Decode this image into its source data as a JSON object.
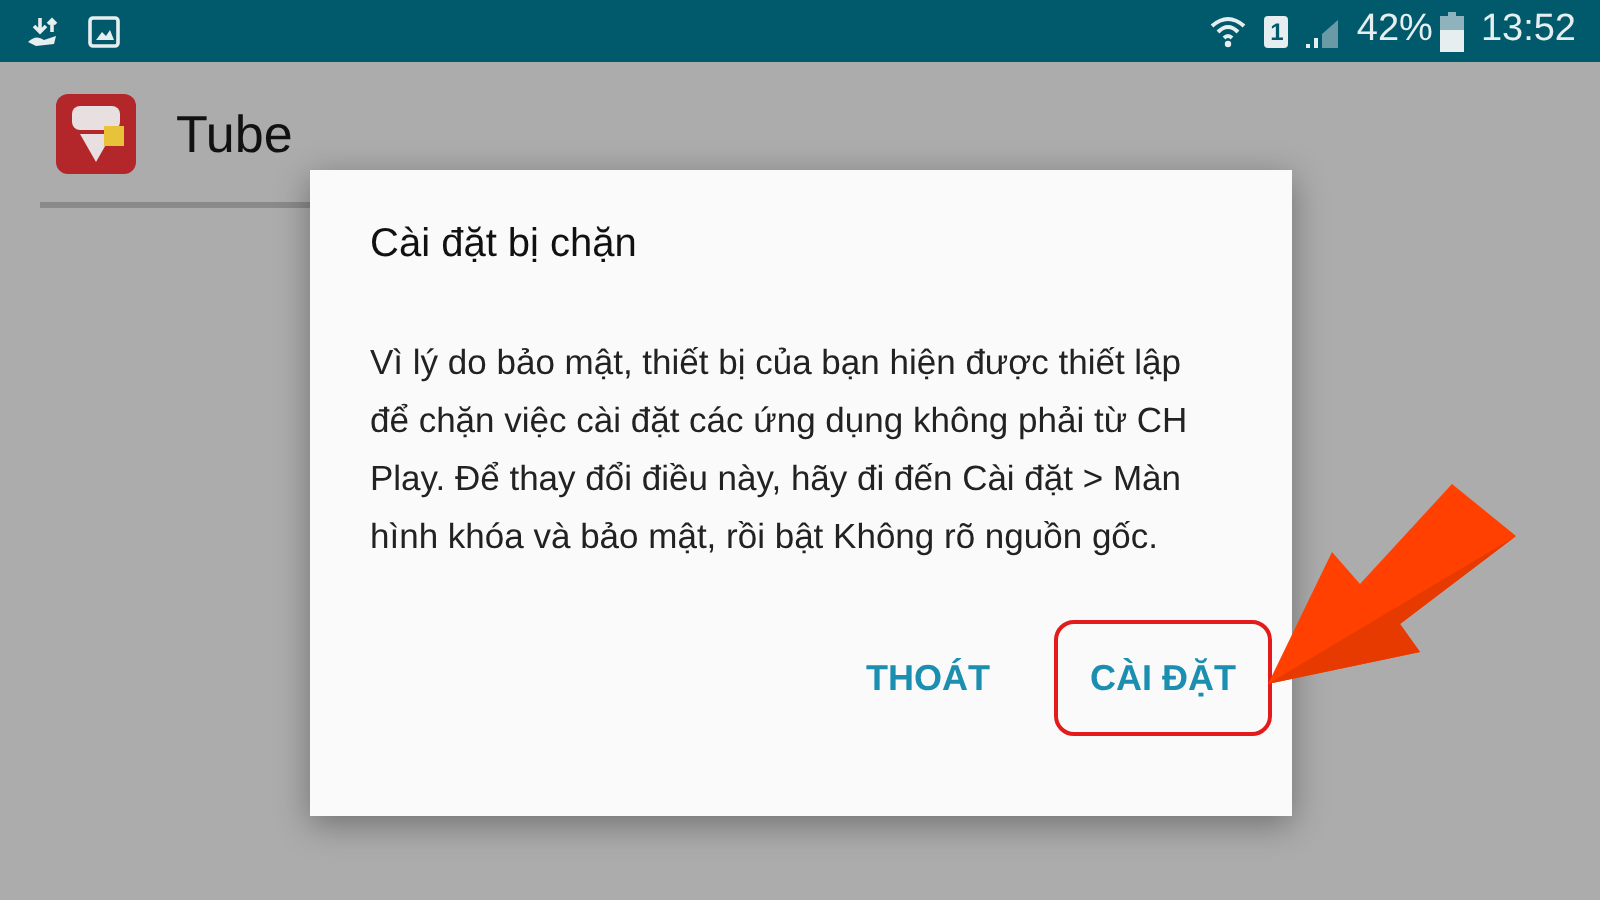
{
  "status_bar": {
    "battery": "42%",
    "time": "13:52",
    "sim": "1"
  },
  "app": {
    "title": "Tube"
  },
  "dialog": {
    "title": "Cài đặt bị chặn",
    "message": "Vì lý do bảo mật, thiết bị của bạn hiện được thiết lập để chặn việc cài đặt các ứng dụng không phải từ CH Play. Để thay đổi điều này, hãy đi đến Cài đặt > Màn hình khóa và bảo mật, rồi bật Không rõ nguồn gốc.",
    "buttons": [
      {
        "label": "THOÁT",
        "highlighted": false
      },
      {
        "label": "CÀI ĐẶT",
        "highlighted": true
      }
    ]
  }
}
